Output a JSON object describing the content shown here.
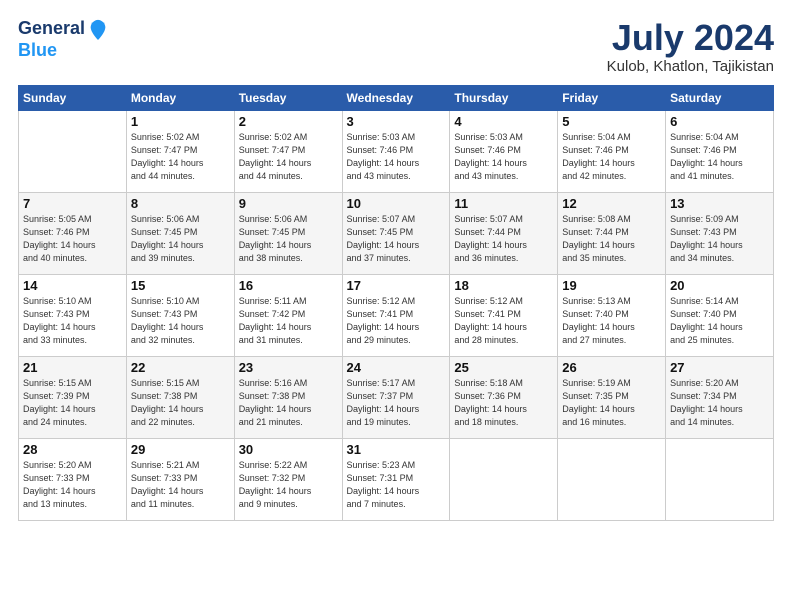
{
  "header": {
    "logo_line1": "General",
    "logo_line2": "Blue",
    "month": "July 2024",
    "location": "Kulob, Khatlon, Tajikistan"
  },
  "weekdays": [
    "Sunday",
    "Monday",
    "Tuesday",
    "Wednesday",
    "Thursday",
    "Friday",
    "Saturday"
  ],
  "weeks": [
    [
      {
        "day": "",
        "info": ""
      },
      {
        "day": "1",
        "info": "Sunrise: 5:02 AM\nSunset: 7:47 PM\nDaylight: 14 hours\nand 44 minutes."
      },
      {
        "day": "2",
        "info": "Sunrise: 5:02 AM\nSunset: 7:47 PM\nDaylight: 14 hours\nand 44 minutes."
      },
      {
        "day": "3",
        "info": "Sunrise: 5:03 AM\nSunset: 7:46 PM\nDaylight: 14 hours\nand 43 minutes."
      },
      {
        "day": "4",
        "info": "Sunrise: 5:03 AM\nSunset: 7:46 PM\nDaylight: 14 hours\nand 43 minutes."
      },
      {
        "day": "5",
        "info": "Sunrise: 5:04 AM\nSunset: 7:46 PM\nDaylight: 14 hours\nand 42 minutes."
      },
      {
        "day": "6",
        "info": "Sunrise: 5:04 AM\nSunset: 7:46 PM\nDaylight: 14 hours\nand 41 minutes."
      }
    ],
    [
      {
        "day": "7",
        "info": "Sunrise: 5:05 AM\nSunset: 7:46 PM\nDaylight: 14 hours\nand 40 minutes."
      },
      {
        "day": "8",
        "info": "Sunrise: 5:06 AM\nSunset: 7:45 PM\nDaylight: 14 hours\nand 39 minutes."
      },
      {
        "day": "9",
        "info": "Sunrise: 5:06 AM\nSunset: 7:45 PM\nDaylight: 14 hours\nand 38 minutes."
      },
      {
        "day": "10",
        "info": "Sunrise: 5:07 AM\nSunset: 7:45 PM\nDaylight: 14 hours\nand 37 minutes."
      },
      {
        "day": "11",
        "info": "Sunrise: 5:07 AM\nSunset: 7:44 PM\nDaylight: 14 hours\nand 36 minutes."
      },
      {
        "day": "12",
        "info": "Sunrise: 5:08 AM\nSunset: 7:44 PM\nDaylight: 14 hours\nand 35 minutes."
      },
      {
        "day": "13",
        "info": "Sunrise: 5:09 AM\nSunset: 7:43 PM\nDaylight: 14 hours\nand 34 minutes."
      }
    ],
    [
      {
        "day": "14",
        "info": "Sunrise: 5:10 AM\nSunset: 7:43 PM\nDaylight: 14 hours\nand 33 minutes."
      },
      {
        "day": "15",
        "info": "Sunrise: 5:10 AM\nSunset: 7:43 PM\nDaylight: 14 hours\nand 32 minutes."
      },
      {
        "day": "16",
        "info": "Sunrise: 5:11 AM\nSunset: 7:42 PM\nDaylight: 14 hours\nand 31 minutes."
      },
      {
        "day": "17",
        "info": "Sunrise: 5:12 AM\nSunset: 7:41 PM\nDaylight: 14 hours\nand 29 minutes."
      },
      {
        "day": "18",
        "info": "Sunrise: 5:12 AM\nSunset: 7:41 PM\nDaylight: 14 hours\nand 28 minutes."
      },
      {
        "day": "19",
        "info": "Sunrise: 5:13 AM\nSunset: 7:40 PM\nDaylight: 14 hours\nand 27 minutes."
      },
      {
        "day": "20",
        "info": "Sunrise: 5:14 AM\nSunset: 7:40 PM\nDaylight: 14 hours\nand 25 minutes."
      }
    ],
    [
      {
        "day": "21",
        "info": "Sunrise: 5:15 AM\nSunset: 7:39 PM\nDaylight: 14 hours\nand 24 minutes."
      },
      {
        "day": "22",
        "info": "Sunrise: 5:15 AM\nSunset: 7:38 PM\nDaylight: 14 hours\nand 22 minutes."
      },
      {
        "day": "23",
        "info": "Sunrise: 5:16 AM\nSunset: 7:38 PM\nDaylight: 14 hours\nand 21 minutes."
      },
      {
        "day": "24",
        "info": "Sunrise: 5:17 AM\nSunset: 7:37 PM\nDaylight: 14 hours\nand 19 minutes."
      },
      {
        "day": "25",
        "info": "Sunrise: 5:18 AM\nSunset: 7:36 PM\nDaylight: 14 hours\nand 18 minutes."
      },
      {
        "day": "26",
        "info": "Sunrise: 5:19 AM\nSunset: 7:35 PM\nDaylight: 14 hours\nand 16 minutes."
      },
      {
        "day": "27",
        "info": "Sunrise: 5:20 AM\nSunset: 7:34 PM\nDaylight: 14 hours\nand 14 minutes."
      }
    ],
    [
      {
        "day": "28",
        "info": "Sunrise: 5:20 AM\nSunset: 7:33 PM\nDaylight: 14 hours\nand 13 minutes."
      },
      {
        "day": "29",
        "info": "Sunrise: 5:21 AM\nSunset: 7:33 PM\nDaylight: 14 hours\nand 11 minutes."
      },
      {
        "day": "30",
        "info": "Sunrise: 5:22 AM\nSunset: 7:32 PM\nDaylight: 14 hours\nand 9 minutes."
      },
      {
        "day": "31",
        "info": "Sunrise: 5:23 AM\nSunset: 7:31 PM\nDaylight: 14 hours\nand 7 minutes."
      },
      {
        "day": "",
        "info": ""
      },
      {
        "day": "",
        "info": ""
      },
      {
        "day": "",
        "info": ""
      }
    ]
  ]
}
